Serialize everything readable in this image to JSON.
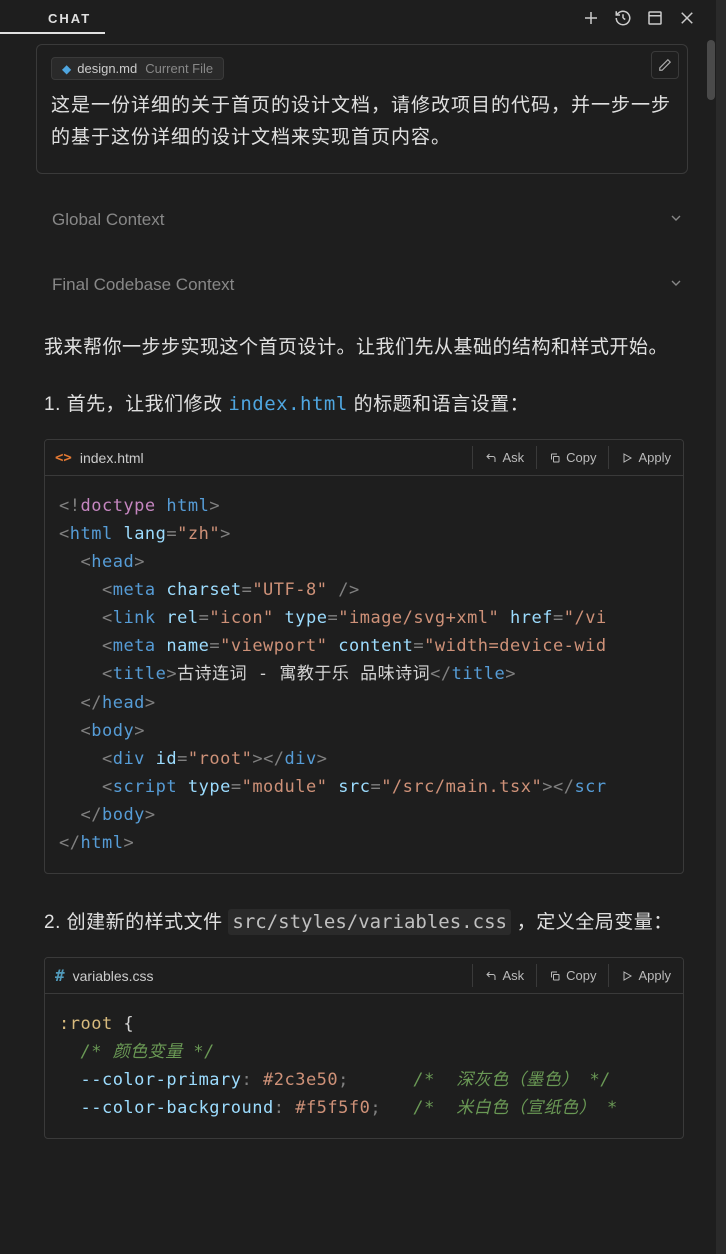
{
  "header": {
    "title": "CHAT",
    "icons": {
      "plus": "plus-icon",
      "history": "history-icon",
      "window": "window-icon",
      "close": "close-icon"
    }
  },
  "context_box": {
    "file_chip": {
      "name": "design.md",
      "label": "Current File"
    },
    "user_message": "这是一份详细的关于首页的设计文档，请修改项目的代码，并一步一步的基于这份详细的设计文档来实现首页内容。"
  },
  "sections": {
    "global": "Global Context",
    "final": "Final Codebase Context"
  },
  "assistant": {
    "intro": "我来帮你一步步实现这个首页设计。让我们先从基础的结构和样式开始。",
    "step1_prefix": "1. 首先，让我们修改 ",
    "step1_file": "index.html",
    "step1_suffix": " 的标题和语言设置：",
    "step2_prefix": "2. 创建新的样式文件 ",
    "step2_path": "src/styles/variables.css",
    "step2_suffix": " ，定义全局变量：",
    "code1": {
      "filename": "index.html",
      "actions": {
        "ask": "Ask",
        "copy": "Copy",
        "apply": "Apply"
      },
      "tokens": {
        "l1": {
          "doctype": "doctype",
          "html": "html"
        },
        "l2": {
          "tag": "html",
          "attr": "lang",
          "val": "\"zh\""
        },
        "l3": {
          "tag": "head"
        },
        "l4": {
          "tag": "meta",
          "a1": "charset",
          "v1": "\"UTF-8\""
        },
        "l5": {
          "tag": "link",
          "a1": "rel",
          "v1": "\"icon\"",
          "a2": "type",
          "v2": "\"image/svg+xml\"",
          "a3": "href",
          "v3": "\"/vi"
        },
        "l6": {
          "tag": "meta",
          "a1": "name",
          "v1": "\"viewport\"",
          "a2": "content",
          "v2": "\"width=device-wid"
        },
        "l7": {
          "tag": "title",
          "text": "古诗连词 - 寓教于乐 品味诗词"
        },
        "l8": {
          "tag": "head"
        },
        "l9": {
          "tag": "body"
        },
        "l10": {
          "tag": "div",
          "a1": "id",
          "v1": "\"root\""
        },
        "l11": {
          "tag": "script",
          "a1": "type",
          "v1": "\"module\"",
          "a2": "src",
          "v2": "\"/src/main.tsx\"",
          "close": "scr"
        },
        "l12": {
          "tag": "body"
        },
        "l13": {
          "tag": "html"
        }
      }
    },
    "code2": {
      "filename": "variables.css",
      "actions": {
        "ask": "Ask",
        "copy": "Copy",
        "apply": "Apply"
      },
      "tokens": {
        "l1": {
          "sel": ":root",
          "brace": " {"
        },
        "l2": {
          "comment": "/* 颜色变量 */"
        },
        "l3": {
          "prop": "--color-primary",
          "val": "#2c3e50",
          "comment": "/*  深灰色（墨色） */"
        },
        "l4": {
          "prop": "--color-background",
          "val": "#f5f5f0",
          "comment": "/*  米白色（宣纸色） *"
        }
      }
    }
  }
}
